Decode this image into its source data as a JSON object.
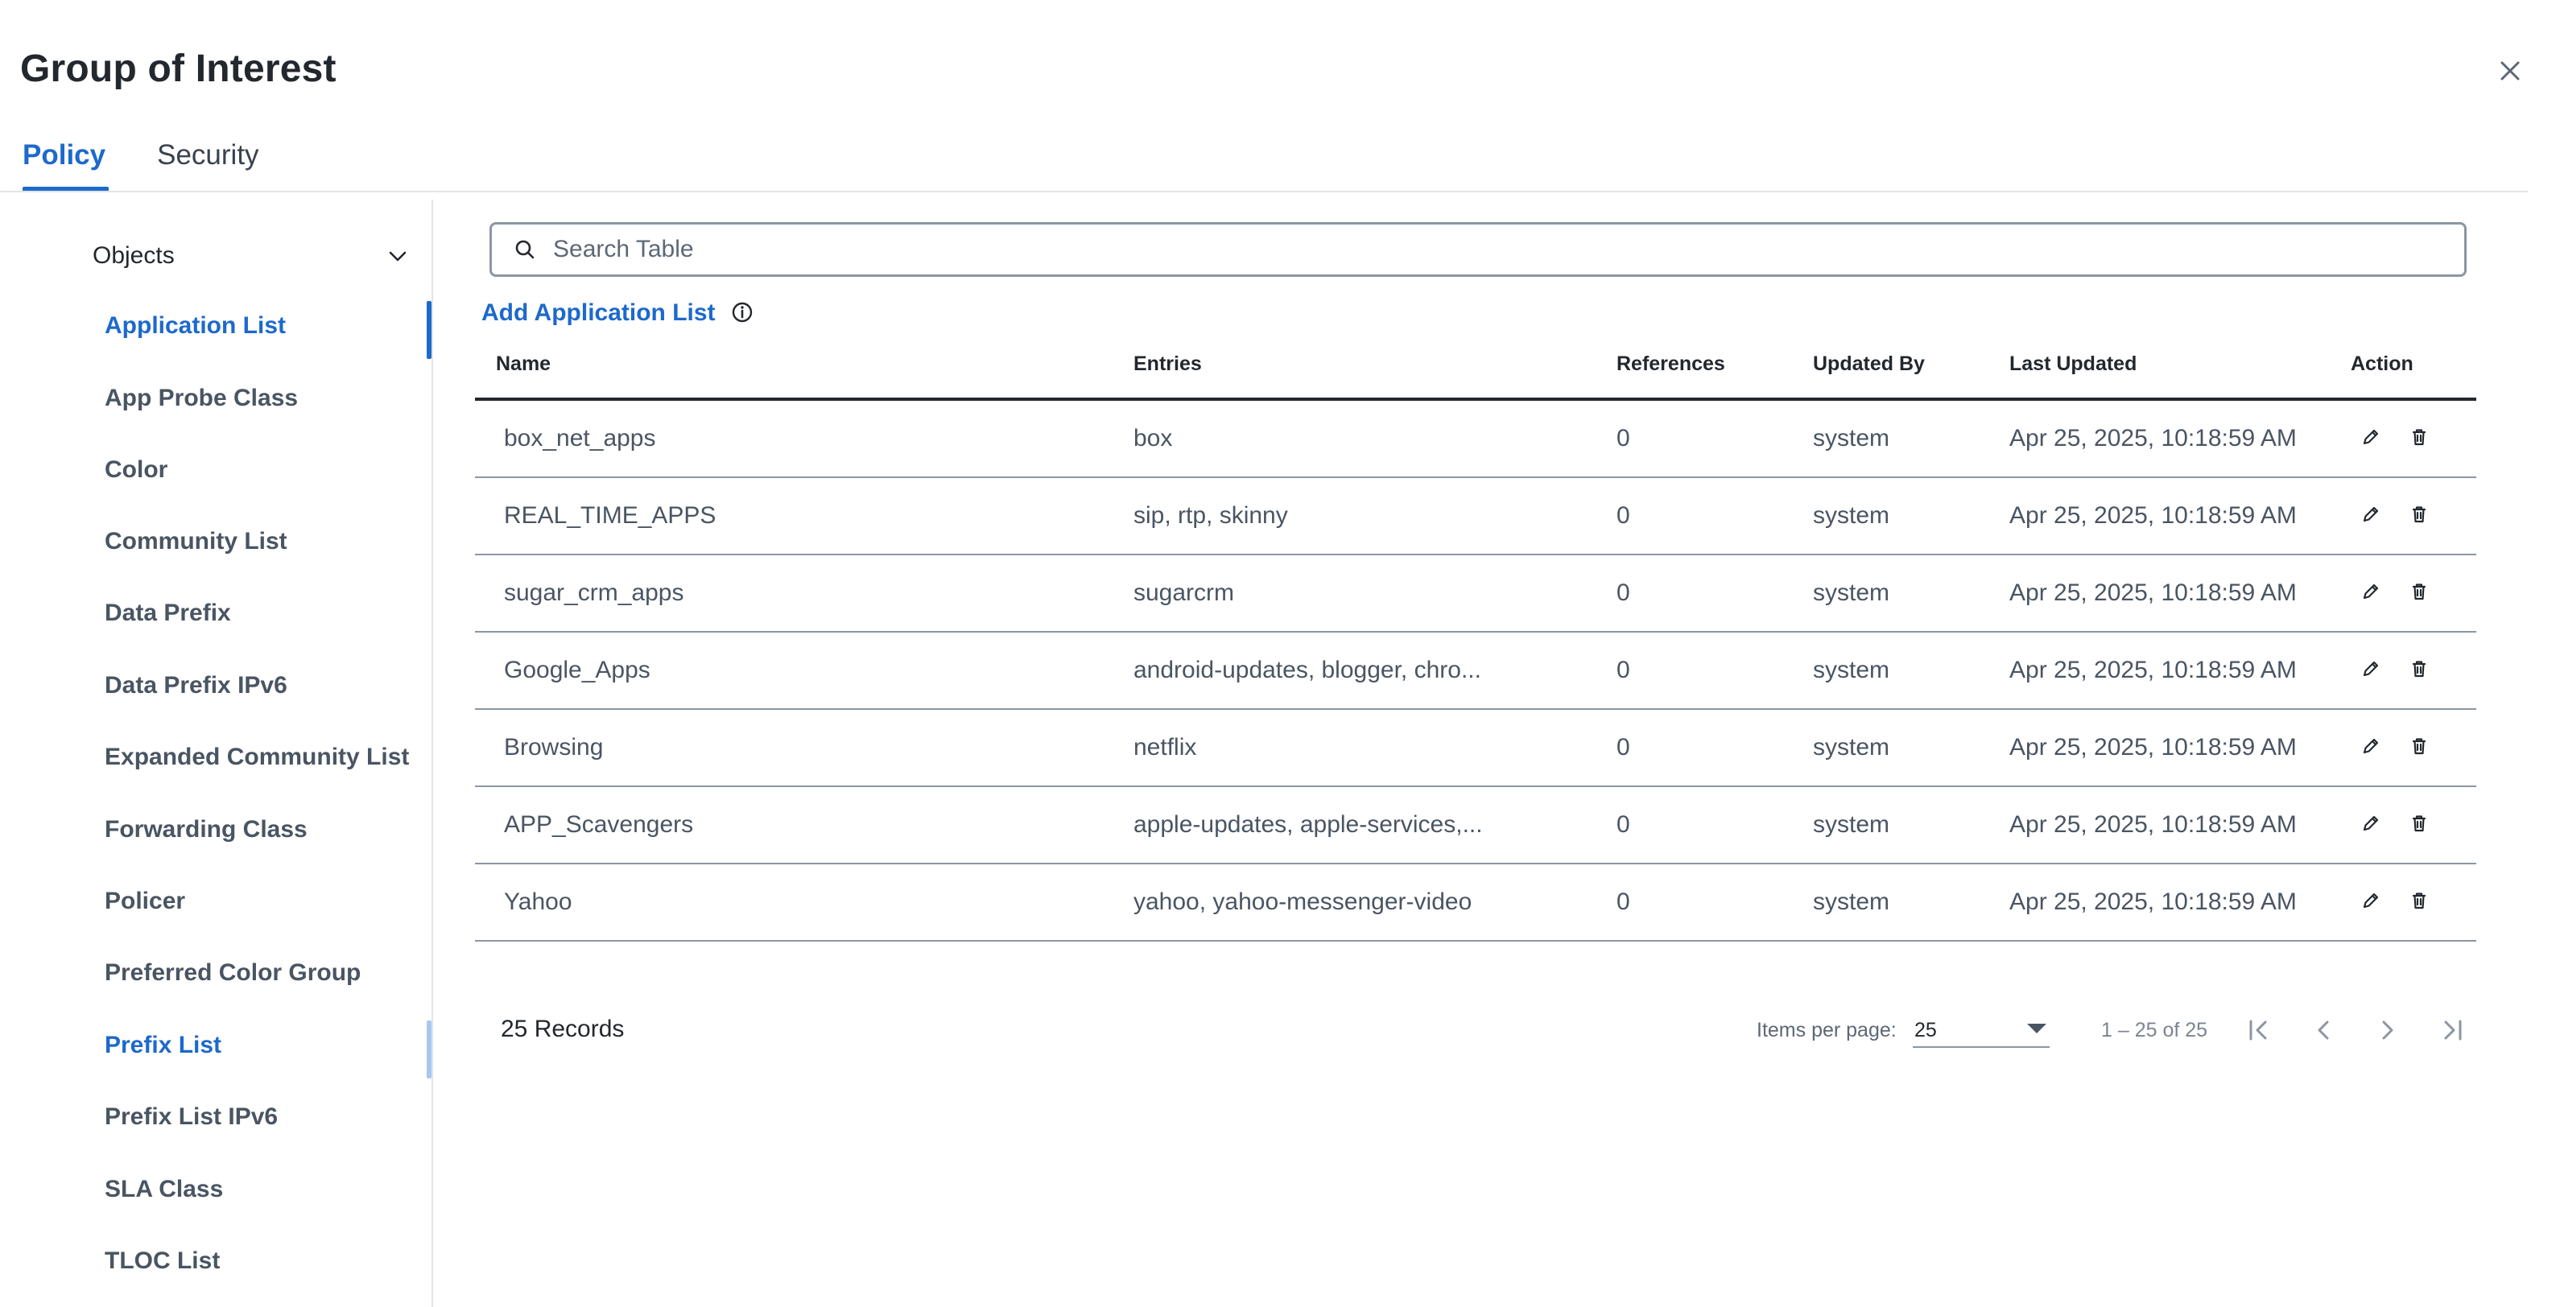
{
  "dialog": {
    "title": "Group of Interest"
  },
  "tabs": [
    {
      "label": "Policy",
      "active": true
    },
    {
      "label": "Security",
      "active": false
    }
  ],
  "sidebar": {
    "section_label": "Objects",
    "items": [
      {
        "label": "Application List",
        "active": true
      },
      {
        "label": "App Probe Class"
      },
      {
        "label": "Color"
      },
      {
        "label": "Community List"
      },
      {
        "label": "Data Prefix"
      },
      {
        "label": "Data Prefix IPv6"
      },
      {
        "label": "Expanded Community List"
      },
      {
        "label": "Forwarding Class"
      },
      {
        "label": "Policer"
      },
      {
        "label": "Preferred Color Group"
      },
      {
        "label": "Prefix List",
        "highlighted": true
      },
      {
        "label": "Prefix List IPv6"
      },
      {
        "label": "SLA Class"
      },
      {
        "label": "TLOC List"
      }
    ]
  },
  "search": {
    "placeholder": "Search Table"
  },
  "add_link": "Add Application List",
  "table": {
    "columns": [
      "Name",
      "Entries",
      "References",
      "Updated By",
      "Last Updated",
      "Action"
    ],
    "rows": [
      {
        "name": "box_net_apps",
        "entries": "box",
        "references": "0",
        "updated_by": "system",
        "last_updated": "Apr 25, 2025, 10:18:59 AM"
      },
      {
        "name": "REAL_TIME_APPS",
        "entries": "sip, rtp, skinny",
        "references": "0",
        "updated_by": "system",
        "last_updated": "Apr 25, 2025, 10:18:59 AM"
      },
      {
        "name": "sugar_crm_apps",
        "entries": "sugarcrm",
        "references": "0",
        "updated_by": "system",
        "last_updated": "Apr 25, 2025, 10:18:59 AM"
      },
      {
        "name": "Google_Apps",
        "entries": "android-updates, blogger, chro...",
        "references": "0",
        "updated_by": "system",
        "last_updated": "Apr 25, 2025, 10:18:59 AM"
      },
      {
        "name": "Browsing",
        "entries": "netflix",
        "references": "0",
        "updated_by": "system",
        "last_updated": "Apr 25, 2025, 10:18:59 AM"
      },
      {
        "name": "APP_Scavengers",
        "entries": "apple-updates, apple-services,...",
        "references": "0",
        "updated_by": "system",
        "last_updated": "Apr 25, 2025, 10:18:59 AM"
      },
      {
        "name": "Yahoo",
        "entries": "yahoo, yahoo-messenger-video",
        "references": "0",
        "updated_by": "system",
        "last_updated": "Apr 25, 2025, 10:18:59 AM"
      }
    ]
  },
  "footer": {
    "records": "25 Records",
    "items_per_page_label": "Items per page:",
    "items_per_page_value": "25",
    "range": "1 – 25 of 25"
  },
  "icons": {
    "close": "close-icon",
    "search": "search-icon",
    "info": "info-icon",
    "edit": "pencil-icon",
    "delete": "trash-icon",
    "chevron": "chevron-down-icon"
  },
  "colors": {
    "accent": "#1d69cc",
    "text": "#39434f",
    "heading": "#23282e",
    "border": "#8b96a3"
  }
}
